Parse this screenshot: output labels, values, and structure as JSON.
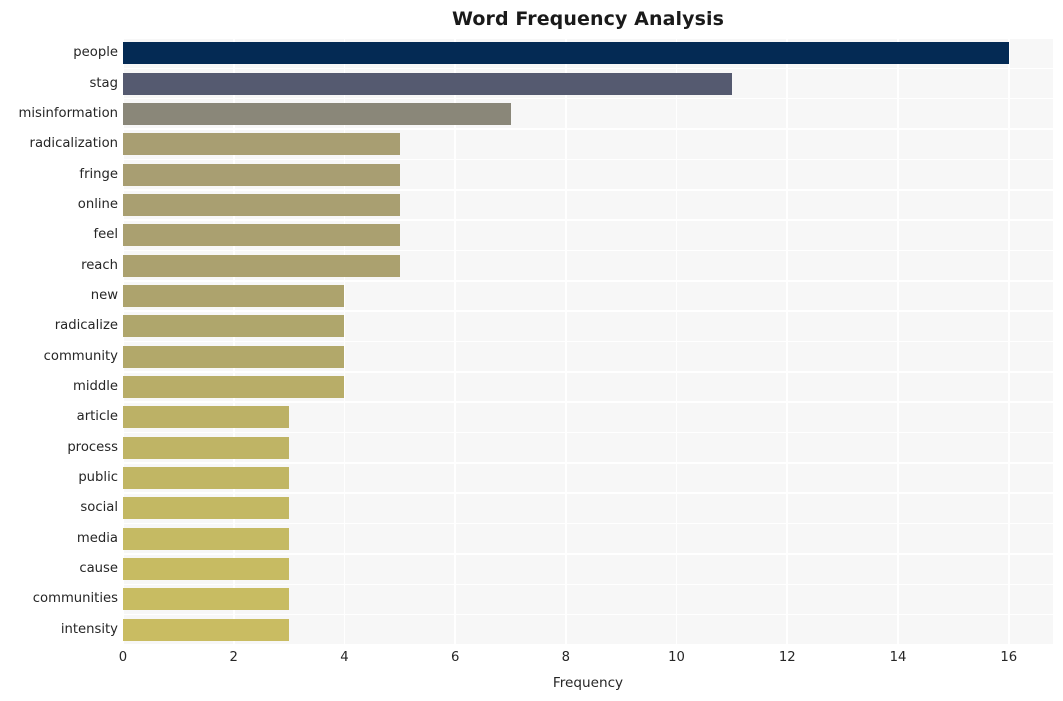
{
  "chart_data": {
    "type": "bar",
    "orientation": "horizontal",
    "title": "Word Frequency Analysis",
    "xlabel": "Frequency",
    "ylabel": "",
    "xlim": [
      0,
      16.8
    ],
    "xticks": [
      0,
      2,
      4,
      6,
      8,
      10,
      12,
      14,
      16
    ],
    "xtick_labels": [
      "0",
      "2",
      "4",
      "6",
      "8",
      "10",
      "12",
      "14",
      "16"
    ],
    "grid": true,
    "grid_color": "#ffffff",
    "plot_background": "#f7f7f7",
    "figure_background": "#ffffff",
    "legend": null,
    "categories": [
      "people",
      "stag",
      "misinformation",
      "radicalization",
      "fringe",
      "online",
      "feel",
      "reach",
      "new",
      "radicalize",
      "community",
      "middle",
      "article",
      "process",
      "public",
      "social",
      "media",
      "cause",
      "communities",
      "intensity"
    ],
    "values": [
      16,
      11,
      7,
      5,
      5,
      5,
      5,
      5,
      4,
      4,
      4,
      4,
      3,
      3,
      3,
      3,
      3,
      3,
      3,
      3
    ],
    "bar_colors": [
      "#042a54",
      "#555a70",
      "#8a8779",
      "#a89e72",
      "#a89e72",
      "#a99f71",
      "#aaa070",
      "#aba16f",
      "#ada36d",
      "#afa66c",
      "#b2a86a",
      "#b8ad68",
      "#bcb166",
      "#bfb465",
      "#c1b664",
      "#c3b863",
      "#c5ba63",
      "#c7bb62",
      "#c8bc62",
      "#c9bc62"
    ]
  }
}
